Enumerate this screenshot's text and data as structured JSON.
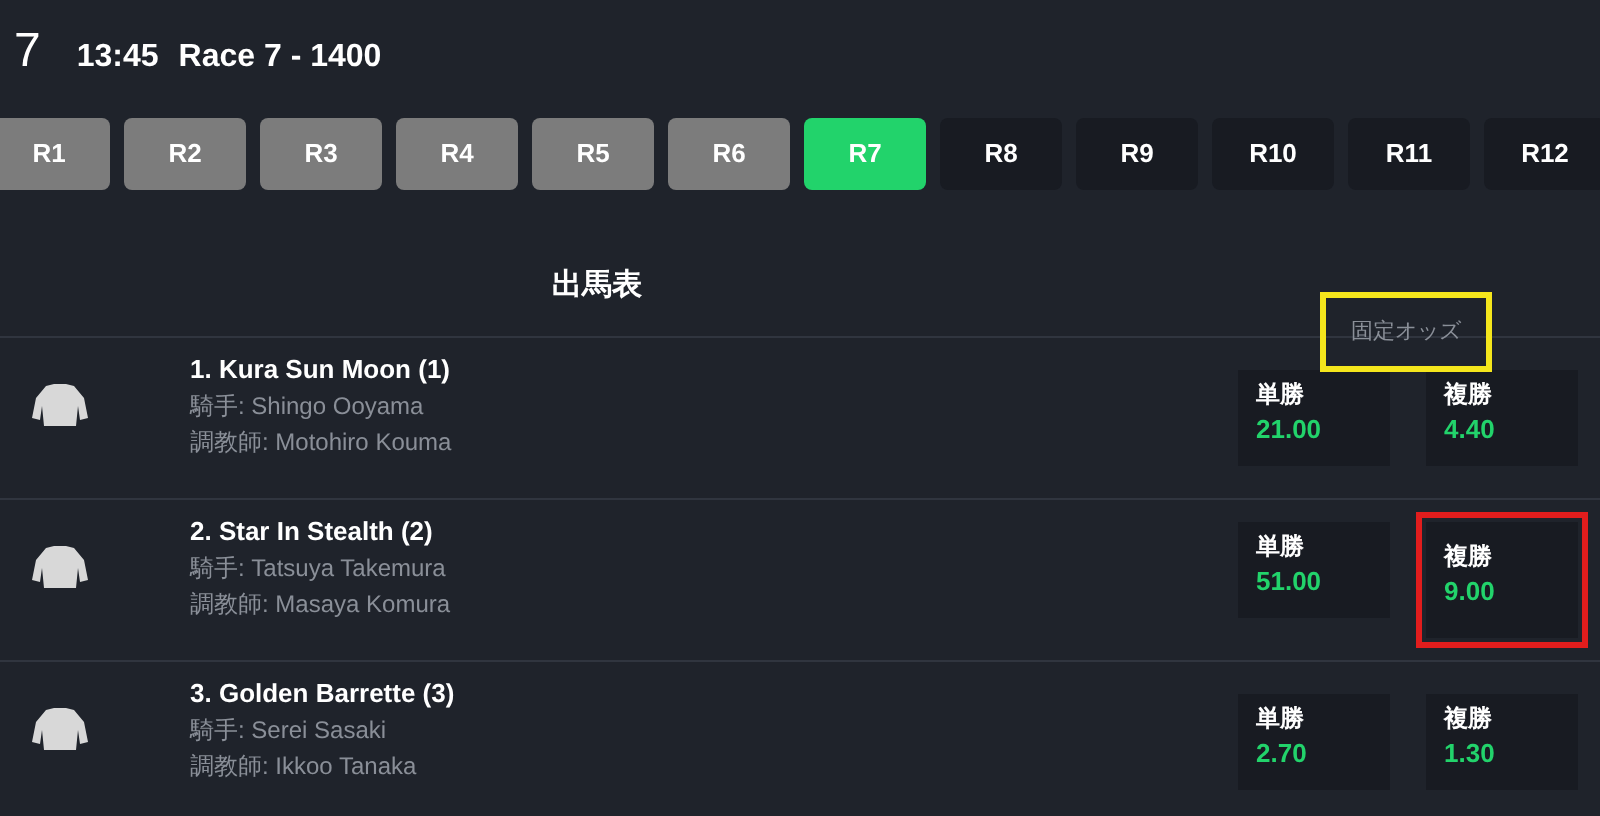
{
  "header": {
    "race_number": "7",
    "time": "13:45",
    "title": "Race 7 - 1400"
  },
  "race_tabs": [
    {
      "label": "R1",
      "selected": false,
      "finished": true
    },
    {
      "label": "R2",
      "selected": false,
      "finished": true
    },
    {
      "label": "R3",
      "selected": false,
      "finished": true
    },
    {
      "label": "R4",
      "selected": false,
      "finished": true
    },
    {
      "label": "R5",
      "selected": false,
      "finished": true
    },
    {
      "label": "R6",
      "selected": false,
      "finished": true
    },
    {
      "label": "R7",
      "selected": true,
      "finished": false
    },
    {
      "label": "R8",
      "selected": false,
      "finished": false
    },
    {
      "label": "R9",
      "selected": false,
      "finished": false
    },
    {
      "label": "R10",
      "selected": false,
      "finished": false
    },
    {
      "label": "R11",
      "selected": false,
      "finished": false
    },
    {
      "label": "R12",
      "selected": false,
      "finished": false
    }
  ],
  "section_title": "出馬表",
  "odds_header": {
    "label": "固定オッズ",
    "highlighted": true
  },
  "runners": [
    {
      "name": "1. Kura Sun Moon (1)",
      "jockey": "騎手: Shingo Ooyama",
      "trainer": "調教師: Motohiro Kouma",
      "odds": [
        {
          "label": "単勝",
          "value": "21.00",
          "highlighted": false
        },
        {
          "label": "複勝",
          "value": "4.40",
          "highlighted": false
        }
      ]
    },
    {
      "name": "2. Star In Stealth (2)",
      "jockey": "騎手: Tatsuya Takemura",
      "trainer": "調教師: Masaya Komura",
      "odds": [
        {
          "label": "単勝",
          "value": "51.00",
          "highlighted": false
        },
        {
          "label": "複勝",
          "value": "9.00",
          "highlighted": true
        }
      ]
    },
    {
      "name": "3. Golden Barrette (3)",
      "jockey": "騎手: Serei Sasaki",
      "trainer": "調教師: Ikkoo Tanaka",
      "odds": [
        {
          "label": "単勝",
          "value": "2.70",
          "highlighted": false
        },
        {
          "label": "複勝",
          "value": "1.30",
          "highlighted": false
        }
      ]
    }
  ]
}
